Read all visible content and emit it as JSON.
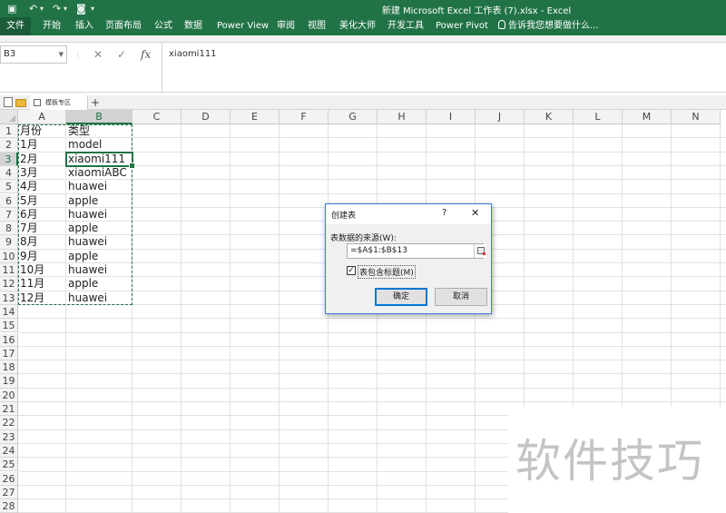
{
  "window": {
    "title": "新建 Microsoft Excel 工作表 (7).xlsx - Excel",
    "quick_access": [
      "save",
      "undo",
      "redo",
      "camera"
    ]
  },
  "ribbon": {
    "tabs": [
      "文件",
      "开始",
      "插入",
      "页面布局",
      "公式",
      "数据",
      "Power View",
      "审阅",
      "视图",
      "美化大师",
      "开发工具",
      "Power Pivot"
    ],
    "tell_me": "告诉我您想要做什么..."
  },
  "formula_bar": {
    "name_box": "B3",
    "formula": "xiaomi111",
    "fx": "fx"
  },
  "workbook_tabs": {
    "tab_label": "模板专区",
    "add": "+"
  },
  "sheet": {
    "columns": [
      "A",
      "B",
      "C",
      "D",
      "E",
      "F",
      "G",
      "H",
      "I",
      "J",
      "K",
      "L",
      "M",
      "N"
    ],
    "rows": [
      "1",
      "2",
      "3",
      "4",
      "5",
      "6",
      "7",
      "8",
      "9",
      "10",
      "11",
      "12",
      "13",
      "14",
      "15",
      "16",
      "17",
      "18",
      "19",
      "20",
      "21",
      "22",
      "23",
      "24",
      "25",
      "26",
      "27",
      "28"
    ],
    "active_cell": "B3",
    "data": [
      [
        "月份",
        "类型"
      ],
      [
        "1月",
        "model"
      ],
      [
        "2月",
        "xiaomi111"
      ],
      [
        "3月",
        "xiaomiABC"
      ],
      [
        "4月",
        "huawei"
      ],
      [
        "5月",
        "apple"
      ],
      [
        "6月",
        "huawei"
      ],
      [
        "7月",
        "apple"
      ],
      [
        "8月",
        "huawei"
      ],
      [
        "9月",
        "apple"
      ],
      [
        "10月",
        "huawei"
      ],
      [
        "11月",
        "apple"
      ],
      [
        "12月",
        "huawei"
      ]
    ]
  },
  "dialog": {
    "title": "创建表",
    "help": "?",
    "close": "✕",
    "source_label": "表数据的来源(W):",
    "source_value": "=$A$1:$B$13",
    "checkbox_label": "表包含标题(M)",
    "checkbox_checked": true,
    "ok": "确定",
    "cancel": "取消"
  },
  "watermark": "软件技巧",
  "colors": {
    "accent": "#217346"
  }
}
